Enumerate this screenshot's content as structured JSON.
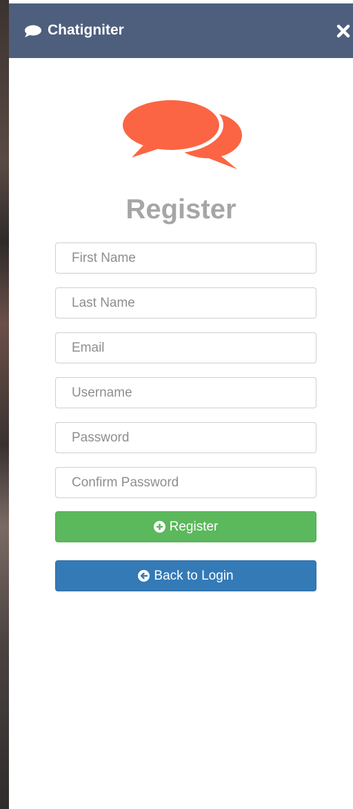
{
  "app": {
    "title": "Chatigniter"
  },
  "icons": {
    "title": "chat-bubble-icon",
    "close": "close-icon",
    "logo": "chat-logo-icon",
    "register": "plus-circle-icon",
    "back": "arrow-circle-left-icon"
  },
  "colors": {
    "titlebar": "#4e5f7d",
    "logo": "#fb6543",
    "heading": "#a6a6a6",
    "register_button": "#5cb85c",
    "login_button": "#337ab7"
  },
  "form": {
    "heading": "Register",
    "fields": [
      {
        "placeholder": "First Name",
        "value": ""
      },
      {
        "placeholder": "Last Name",
        "value": ""
      },
      {
        "placeholder": "Email",
        "value": ""
      },
      {
        "placeholder": "Username",
        "value": ""
      },
      {
        "placeholder": "Password",
        "value": ""
      },
      {
        "placeholder": "Confirm Password",
        "value": ""
      }
    ],
    "register_label": "Register",
    "back_label": "Back to Login"
  }
}
